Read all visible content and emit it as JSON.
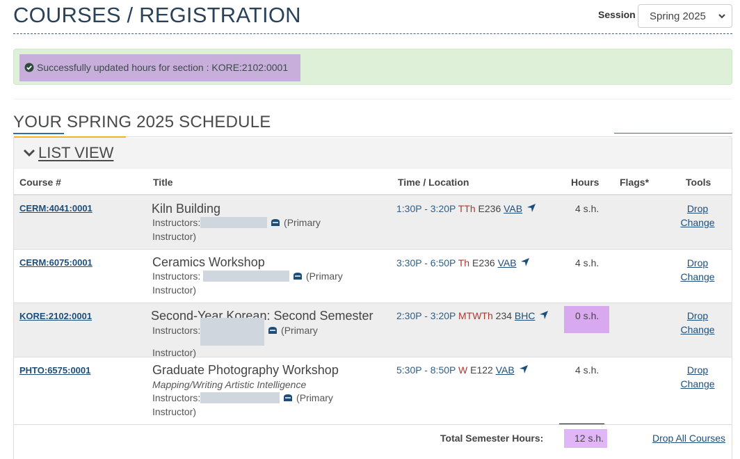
{
  "header": {
    "title": "COURSES / REGISTRATION",
    "session_label": "Session",
    "session_value": "Spring 2025"
  },
  "alert": {
    "icon": "check-circle-icon",
    "message": "Successfully updated hours for section : KORE:2102:0001"
  },
  "schedule": {
    "title": "YOUR SPRING 2025 SCHEDULE",
    "view_toggle": "LIST VIEW",
    "columns": [
      "Course #",
      "Title",
      "Time / Location",
      "Hours",
      "Flags*",
      "Tools"
    ],
    "rows": [
      {
        "course": "CERM:4041:0001",
        "title": "Kiln Building",
        "subtitle": "",
        "instructors_label": "Instructors:",
        "instructor_role": "(Primary Instructor)",
        "time": "1:30P - 3:20P",
        "days": "TTh",
        "room": "E236",
        "building": "VAB",
        "hours": "4 s.h.",
        "flags": "",
        "tools": [
          "Drop",
          "Change"
        ]
      },
      {
        "course": "CERM:6075:0001",
        "title": "Ceramics Workshop",
        "subtitle": "",
        "instructors_label": "Instructors:",
        "instructor_role": "(Primary Instructor)",
        "time": "3:30P - 6:50P",
        "days": "Th",
        "room": "E236",
        "building": "VAB",
        "hours": "4 s.h.",
        "flags": "",
        "tools": [
          "Drop",
          "Change"
        ]
      },
      {
        "course": "KORE:2102:0001",
        "title": "Second-Year Korean: Second Semester",
        "subtitle": "",
        "instructors_label": "Instructors:",
        "instructor_role": "(Primary Instructor)",
        "time": "2:30P - 3:20P",
        "days": "MTWTh",
        "room": "234",
        "building": "BHC",
        "hours": "0 s.h.",
        "flags": "",
        "tools": [
          "Drop",
          "Change"
        ]
      },
      {
        "course": "PHTO:6575:0001",
        "title": "Graduate Photography Workshop",
        "subtitle": "Mapping/Writing Artistic Intelligence",
        "instructors_label": "Instructors:",
        "instructor_role": "(Primary Instructor)",
        "time": "5:30P - 8:50P",
        "days": "W",
        "room": "E122",
        "building": "VAB",
        "hours": "4 s.h.",
        "flags": "",
        "tools": [
          "Drop",
          "Change"
        ]
      }
    ],
    "total_label": "Total Semester Hours:",
    "total_value": "12 s.h.",
    "drop_all": "Drop All Courses"
  },
  "colors": {
    "title": "#2a4259",
    "alert_bg": "#dff0d8",
    "link": "#1d4e7a",
    "days": "#a83a32",
    "highlight": "#d8a9ef",
    "accent_gold": "#f0b429"
  }
}
